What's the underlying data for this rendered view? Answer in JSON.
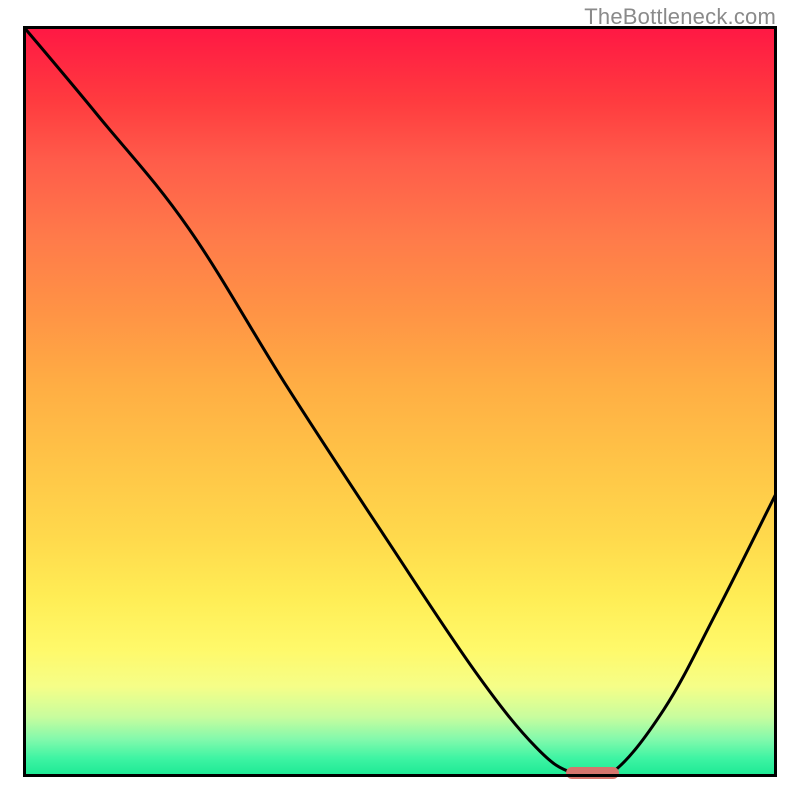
{
  "watermark": "TheBottleneck.com",
  "chart_data": {
    "type": "line",
    "title": "",
    "xlabel": "",
    "ylabel": "",
    "xlim": [
      0,
      100
    ],
    "ylim": [
      0,
      100
    ],
    "grid": false,
    "background": "gradient-red-to-green",
    "series": [
      {
        "name": "bottleneck-curve",
        "x": [
          0,
          10,
          22,
          35,
          48,
          60,
          68,
          73,
          78,
          85,
          92,
          100
        ],
        "values": [
          100,
          88,
          73,
          52,
          32,
          14,
          4,
          0.5,
          0.5,
          9,
          22,
          38
        ]
      }
    ],
    "marker": {
      "name": "optimal-range",
      "x_start": 72,
      "x_end": 79,
      "y": 0.5,
      "color": "#d5756d"
    },
    "colors": {
      "gradient_top": "#ff1744",
      "gradient_bottom": "#19e893",
      "curve": "#000000",
      "marker": "#d5756d"
    }
  }
}
